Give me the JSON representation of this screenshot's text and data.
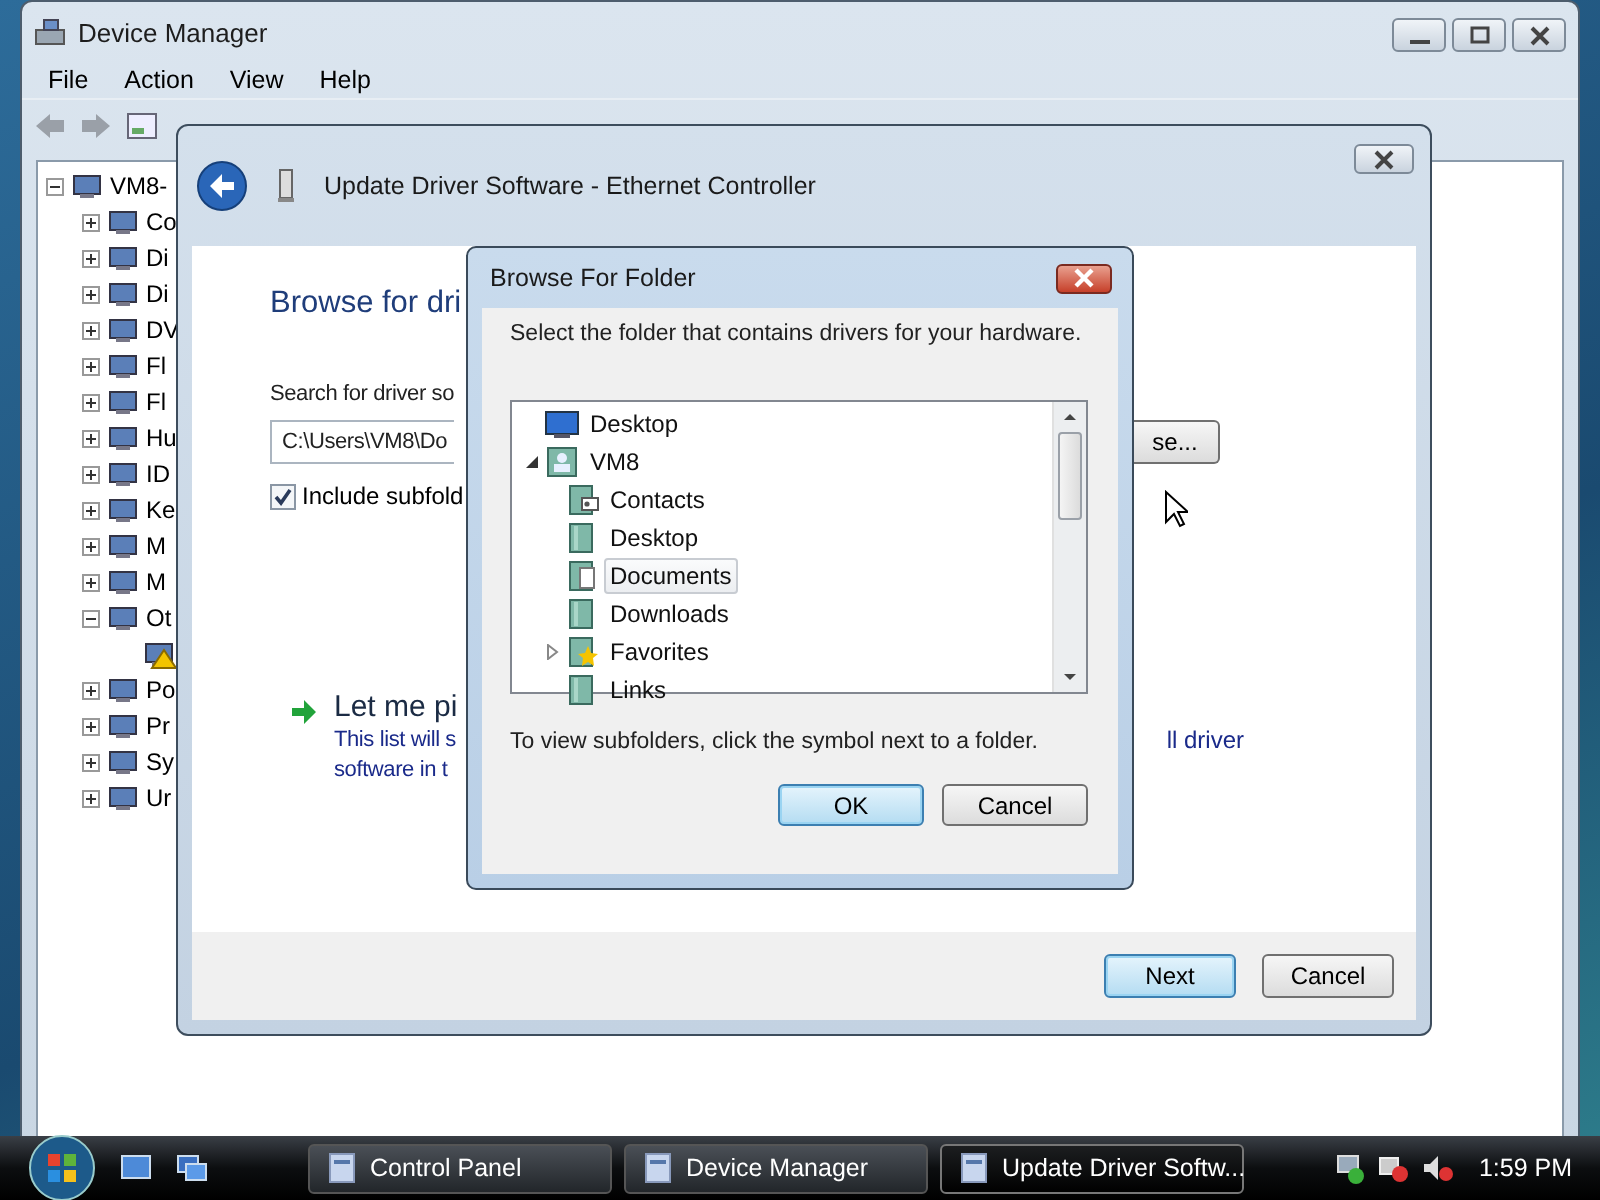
{
  "device_manager": {
    "title": "Device Manager",
    "menu": [
      "File",
      "Action",
      "View",
      "Help"
    ],
    "tree": [
      {
        "label": "VM8-",
        "expanded": true,
        "children": [
          {
            "label": "Co",
            "expanded": false
          },
          {
            "label": "Di",
            "expanded": false
          },
          {
            "label": "Di",
            "expanded": false
          },
          {
            "label": "DV",
            "expanded": false
          },
          {
            "label": "Fl",
            "expanded": false
          },
          {
            "label": "Fl",
            "expanded": false
          },
          {
            "label": "Hu",
            "expanded": false
          },
          {
            "label": "ID",
            "expanded": false
          },
          {
            "label": "Ke",
            "expanded": false
          },
          {
            "label": "M",
            "expanded": false
          },
          {
            "label": "M",
            "expanded": false
          },
          {
            "label": "Ot",
            "expanded": true,
            "children": [
              {
                "warning": true
              }
            ]
          },
          {
            "label": "Po",
            "expanded": false
          },
          {
            "label": "Pr",
            "expanded": false
          },
          {
            "label": "Sy",
            "expanded": false
          },
          {
            "label": "Ur",
            "expanded": false
          }
        ]
      }
    ]
  },
  "update_driver": {
    "title": "Update Driver Software - Ethernet Controller",
    "heading": "Browse for dri",
    "search_label": "Search for driver so",
    "path": "C:\\Users\\VM8\\Do",
    "browse_button": "se...",
    "include_subfolders": {
      "label": "Include subfold",
      "checked": true
    },
    "pick": {
      "title": "Let me pi",
      "lines": [
        "This list will s",
        "software in t"
      ],
      "right_text": "ll driver"
    },
    "buttons": [
      {
        "label": "Next",
        "default": true
      },
      {
        "label": "Cancel",
        "default": false
      }
    ]
  },
  "browse_folder": {
    "title": "Browse For Folder",
    "instruction": "Select the folder that contains drivers for your hardware.",
    "folders": [
      {
        "label": "Desktop",
        "kind": "desktop",
        "selected": false
      },
      {
        "label": "VM8",
        "kind": "user",
        "expanded": true,
        "selected": false,
        "children": [
          {
            "label": "Contacts",
            "kind": "contacts",
            "selected": false
          },
          {
            "label": "Desktop",
            "kind": "folder",
            "selected": false
          },
          {
            "label": "Documents",
            "kind": "documents",
            "selected": true
          },
          {
            "label": "Downloads",
            "kind": "folder",
            "selected": false
          },
          {
            "label": "Favorites",
            "kind": "favorites",
            "expanded": false,
            "selected": false
          },
          {
            "label": "Links",
            "kind": "folder",
            "selected": false
          }
        ]
      }
    ],
    "hint": "To view subfolders, click the symbol next to a folder.",
    "buttons": [
      {
        "label": "OK",
        "default": true
      },
      {
        "label": "Cancel",
        "default": false
      }
    ]
  },
  "taskbar": {
    "buttons": [
      {
        "label": "Control Panel",
        "selected": false
      },
      {
        "label": "Device Manager",
        "selected": false
      },
      {
        "label": "Update Driver Softw...",
        "selected": true
      }
    ],
    "clock": "1:59 PM"
  }
}
